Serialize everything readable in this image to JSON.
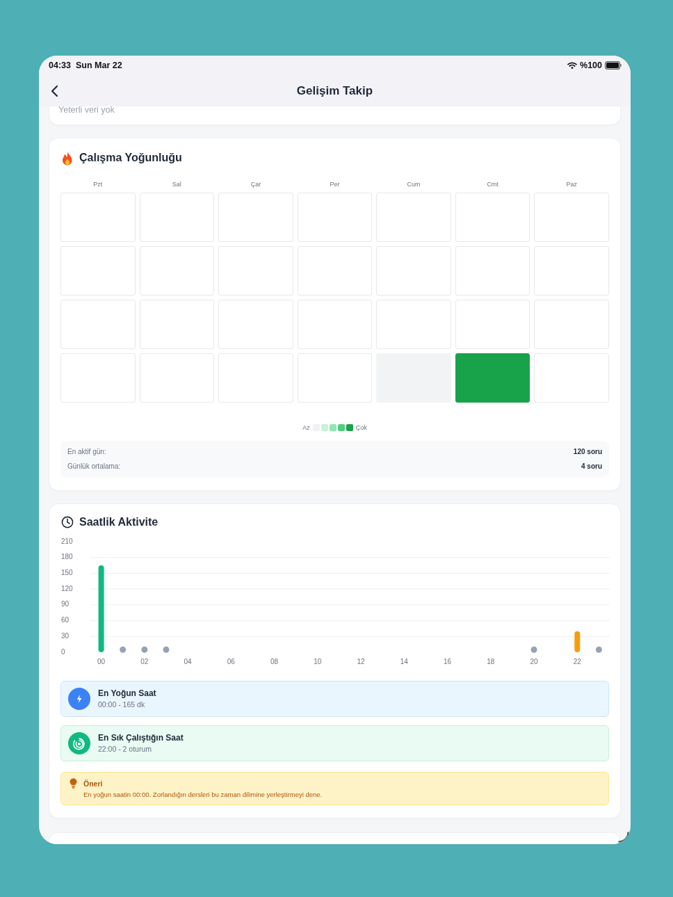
{
  "status_bar": {
    "time": "04:33",
    "date": "Sun Mar 22",
    "battery": "%100"
  },
  "navigation": {
    "title": "Gelişim Takip"
  },
  "summary_card": {
    "message": "Yeterli veri yok"
  },
  "intensity": {
    "title": "Çalışma Yoğunluğu",
    "weekdays": [
      "Pzt",
      "Sal",
      "Çar",
      "Per",
      "Cum",
      "Cmt",
      "Paz"
    ],
    "rows": [
      {
        "cells": [
          {
            "kind": "empty"
          },
          {
            "kind": "empty"
          },
          {
            "kind": "empty"
          },
          {
            "kind": "empty"
          },
          {
            "kind": "empty"
          },
          {
            "kind": "empty"
          },
          {
            "kind": "empty"
          }
        ]
      },
      {
        "cells": [
          {
            "kind": "empty"
          },
          {
            "kind": "empty"
          },
          {
            "kind": "empty"
          },
          {
            "kind": "empty"
          },
          {
            "kind": "empty"
          },
          {
            "kind": "empty"
          },
          {
            "kind": "empty"
          }
        ]
      },
      {
        "cells": [
          {
            "kind": "empty"
          },
          {
            "kind": "empty"
          },
          {
            "kind": "empty"
          },
          {
            "kind": "empty"
          },
          {
            "kind": "empty"
          },
          {
            "kind": "empty"
          },
          {
            "kind": "empty"
          }
        ]
      },
      {
        "cells": [
          {
            "kind": "empty"
          },
          {
            "kind": "empty"
          },
          {
            "kind": "empty"
          },
          {
            "kind": "empty"
          },
          {
            "kind": "day",
            "color": "#f2f3f5"
          },
          {
            "kind": "day",
            "color": "#18a34a"
          },
          {
            "kind": "empty"
          }
        ]
      }
    ],
    "legend": {
      "low": "Az",
      "high": "Çok",
      "swatches": [
        {
          "color": "#eef0f3"
        },
        {
          "color": "#c8f2d6"
        },
        {
          "color": "#92e6b1"
        },
        {
          "color": "#4bd07e"
        },
        {
          "color": "#18a34a"
        }
      ]
    },
    "stats": [
      {
        "label": "En aktif gün:",
        "value": "120 soru"
      },
      {
        "label": "Günlük ortalama:",
        "value": "4 soru"
      }
    ]
  },
  "hourly": {
    "title": "Saatlik Aktivite",
    "chart_data": {
      "type": "bar",
      "x": [
        0,
        1,
        2,
        3,
        20,
        22,
        23
      ],
      "series": [
        {
          "color": "#10b981",
          "values": [
            165,
            null,
            null,
            null,
            null,
            null,
            null
          ]
        },
        {
          "color": "#f59e0b",
          "values": [
            null,
            null,
            null,
            null,
            null,
            40,
            null
          ]
        },
        {
          "type": "scatter",
          "color": "#94a3b8",
          "values": [
            null,
            5,
            5,
            5,
            5,
            null,
            5
          ]
        }
      ],
      "xlim": [
        -0.5,
        23.5
      ],
      "ylim": [
        0,
        210
      ],
      "yticks": [
        0,
        30,
        60,
        90,
        120,
        150,
        180,
        210
      ],
      "grid": true,
      "xticks": [
        {
          "value": 0,
          "label": "00"
        },
        {
          "value": 2,
          "label": "02"
        },
        {
          "value": 4,
          "label": "04"
        },
        {
          "value": 6,
          "label": "06"
        },
        {
          "value": 8,
          "label": "08"
        },
        {
          "value": 10,
          "label": "10"
        },
        {
          "value": 12,
          "label": "12"
        },
        {
          "value": 14,
          "label": "14"
        },
        {
          "value": 16,
          "label": "16"
        },
        {
          "value": 18,
          "label": "18"
        },
        {
          "value": 20,
          "label": "20"
        },
        {
          "value": 22,
          "label": "22"
        }
      ]
    },
    "highlights": [
      {
        "kind": "peak",
        "title": "En Yoğun Saat",
        "detail": "00:00 - 165 dk"
      },
      {
        "kind": "frequent",
        "title": "En Sık Çalıştığın Saat",
        "detail": "22:00 - 2 oturum"
      }
    ],
    "tip": {
      "title": "Öneri",
      "text": "En yoğun saatin 00:00. Zorlandığın dersleri bu zaman dilimine yerleştirmeyi dene."
    }
  }
}
